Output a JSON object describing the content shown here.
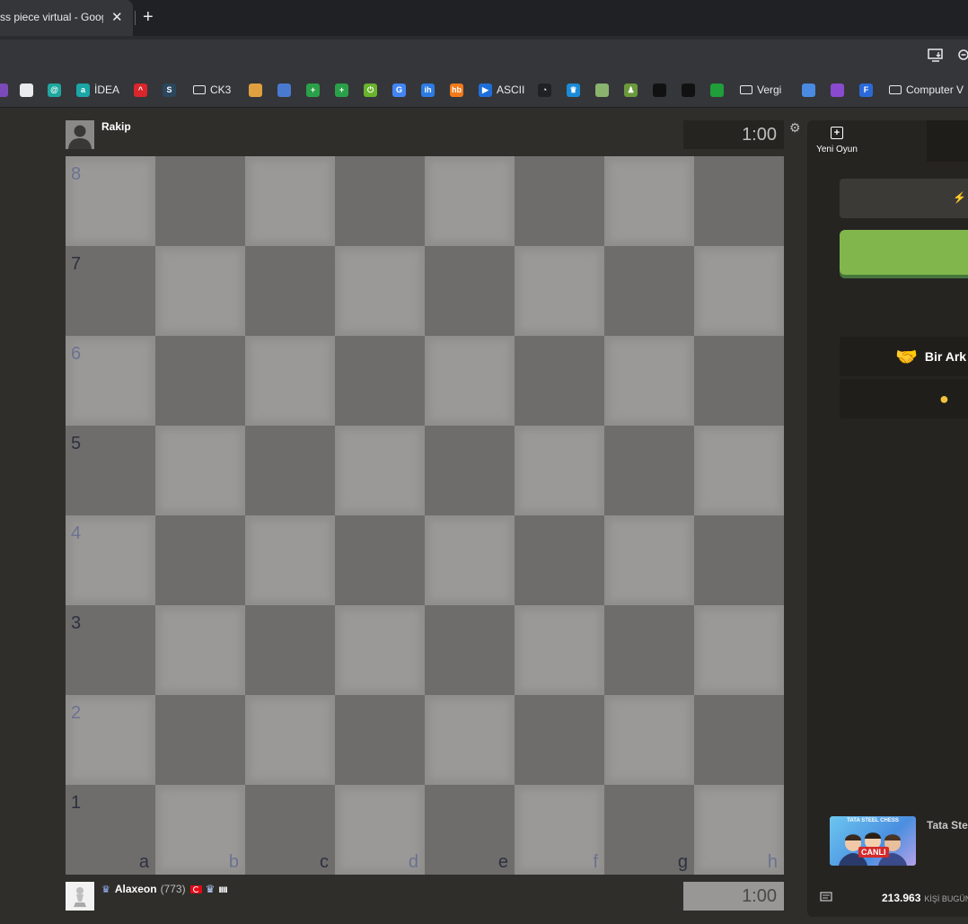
{
  "browser": {
    "tab_title": "ss piece virtual - Goog",
    "tab_close": "✕",
    "new_tab": "+",
    "bookmarks": [
      {
        "icon": "",
        "label": "",
        "color": "#7b4ab8"
      },
      {
        "icon": "",
        "label": "",
        "color": "#e8eaed"
      },
      {
        "icon": "@",
        "label": "",
        "color": "#1ea7a0"
      },
      {
        "icon": "a",
        "label": "İDEA",
        "color": "#1aa6a6"
      },
      {
        "icon": "^",
        "label": "",
        "color": "#d9262b"
      },
      {
        "icon": "S",
        "label": "",
        "color": "#2a475e"
      },
      {
        "icon": "",
        "label": "CK3",
        "folder": true
      },
      {
        "icon": "",
        "label": "",
        "color": "#e0a040"
      },
      {
        "icon": "",
        "label": "",
        "color": "#4a7ad0"
      },
      {
        "icon": "+",
        "label": "",
        "color": "#2aa148"
      },
      {
        "icon": "+",
        "label": "",
        "color": "#2aa148"
      },
      {
        "icon": "⏻",
        "label": "",
        "color": "#6ab32c"
      },
      {
        "icon": "G",
        "label": "",
        "color": "#4285f4"
      },
      {
        "icon": "ih",
        "label": "",
        "color": "#2c7be5"
      },
      {
        "icon": "hb",
        "label": "",
        "color": "#f27a1a"
      },
      {
        "icon": "▶",
        "label": "ASCII",
        "color": "#1e6fd9"
      },
      {
        "icon": "◔",
        "label": "",
        "color": "#202124"
      },
      {
        "icon": "♛",
        "label": "",
        "color": "#1b8bd8"
      },
      {
        "icon": "",
        "label": "",
        "color": "#8ab46e"
      },
      {
        "icon": "♟",
        "label": "",
        "color": "#6a9a3c"
      },
      {
        "icon": "",
        "label": "",
        "color": "#111"
      },
      {
        "icon": "",
        "label": "",
        "color": "#111"
      },
      {
        "icon": "",
        "label": "",
        "color": "#1f9e3a"
      },
      {
        "icon": "",
        "label": "Vergi",
        "folder": true
      },
      {
        "icon": "",
        "label": "",
        "color": "#4a8ae0"
      },
      {
        "icon": "",
        "label": "",
        "color": "#8a4ad0"
      },
      {
        "icon": "F",
        "label": "",
        "color": "#2a6ad8"
      },
      {
        "icon": "",
        "label": "Computer V",
        "folder": true
      }
    ]
  },
  "game": {
    "opponent": {
      "name": "Rakip",
      "clock": "1:00"
    },
    "player": {
      "name": "Alaxeon",
      "rating": "(773)",
      "clock": "1:00",
      "flag_color": "#e30a17",
      "bars": "ıııı"
    },
    "ranks": [
      "8",
      "7",
      "6",
      "5",
      "4",
      "3",
      "2",
      "1"
    ],
    "files": [
      "a",
      "b",
      "c",
      "d",
      "e",
      "f",
      "g",
      "h"
    ],
    "settings_icon": "⚙"
  },
  "panel": {
    "new_game_label": "Yeni Oyun",
    "friend_label": "Bir Ark",
    "promo_banner_text": "TATA STEEL CHESS",
    "promo_live": "CANLI",
    "promo_title": "Tata Ste",
    "count_value": "213.963",
    "count_label": "KİŞİ BUGÜN",
    "accent_color": "#81b64c"
  }
}
